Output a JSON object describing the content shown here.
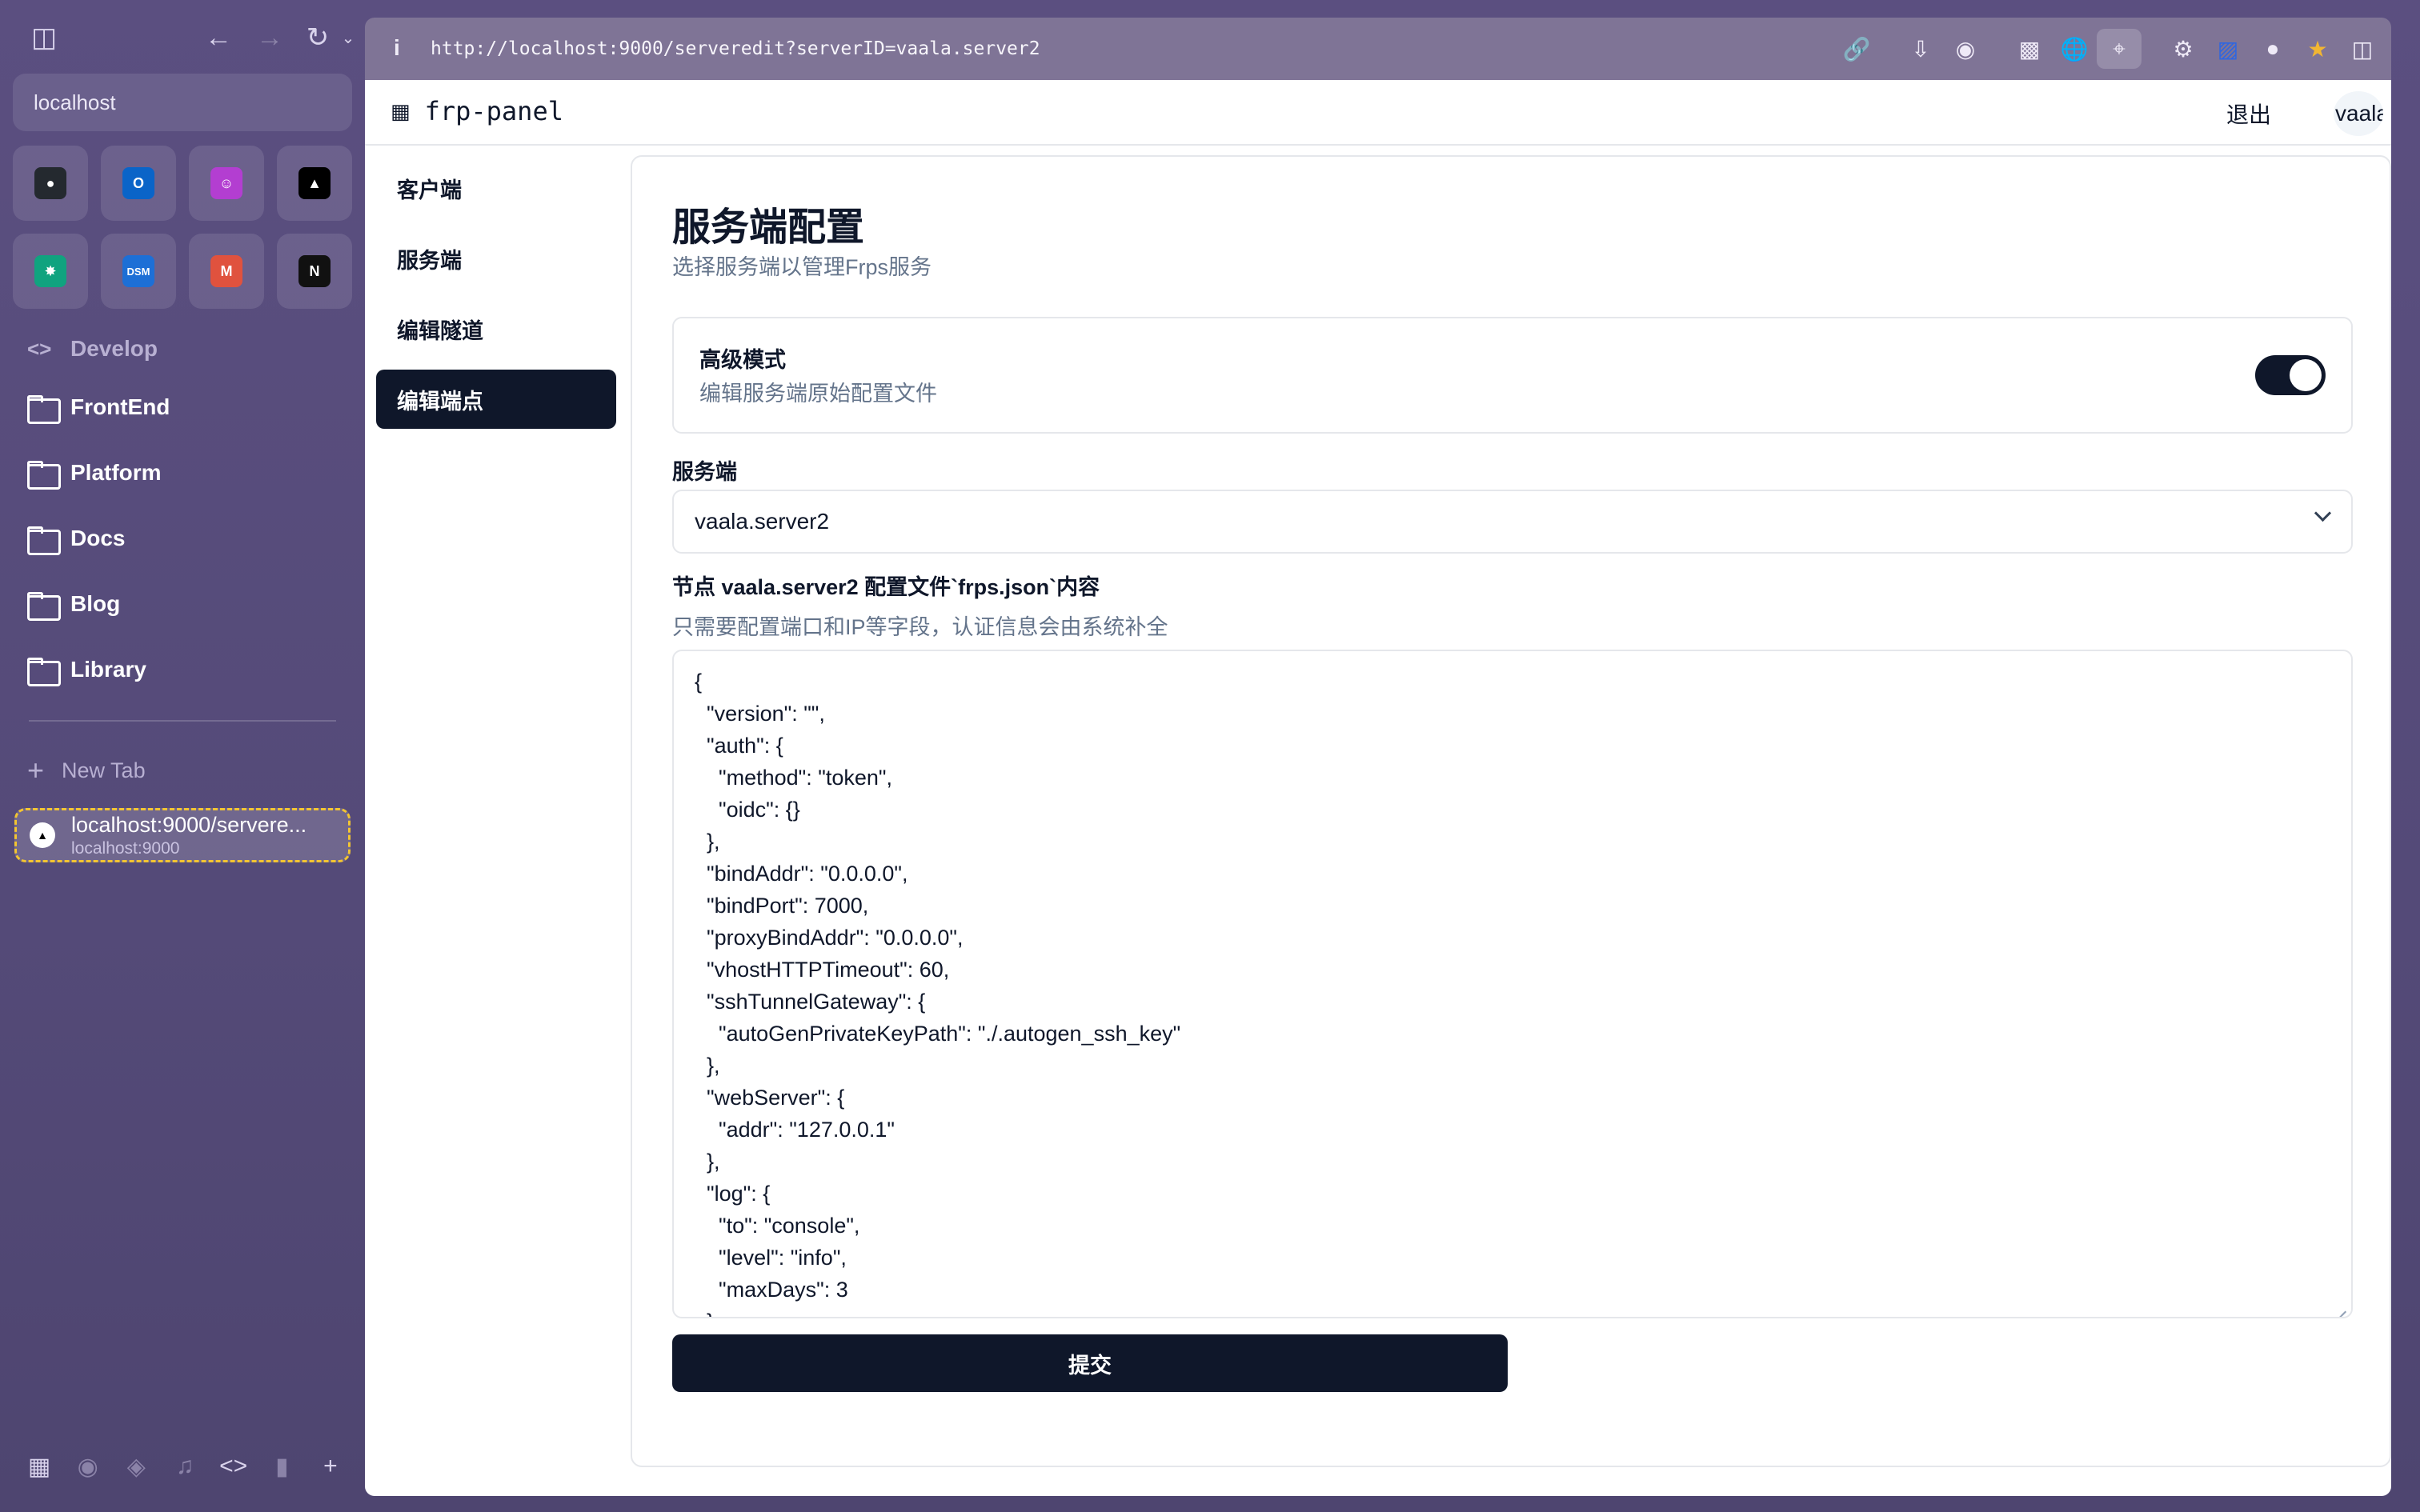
{
  "browser": {
    "url": "http://localhost:9000/serveredit?serverID=vaala.server2",
    "search_value": "localhost",
    "favorites": [
      {
        "icon": "github-icon",
        "symbol": "●",
        "color": "#24292f"
      },
      {
        "icon": "outlook-icon",
        "symbol": "O",
        "color": "#0a64c8"
      },
      {
        "icon": "chat-bot-icon",
        "symbol": "☺",
        "color": "#b33ed1"
      },
      {
        "icon": "vercel-icon",
        "symbol": "▲",
        "color": "#000000"
      },
      {
        "icon": "chatgpt-icon",
        "symbol": "✸",
        "color": "#10a37f"
      },
      {
        "icon": "dsm-icon",
        "symbol": "DSM",
        "color": "#1d6fd6"
      },
      {
        "icon": "gmail-icon",
        "symbol": "M",
        "color": "#e0523e"
      },
      {
        "icon": "notion-icon",
        "symbol": "N",
        "color": "#111111"
      }
    ],
    "sidebar": {
      "develop": "Develop",
      "folders": [
        "FrontEnd",
        "Platform",
        "Docs",
        "Blog",
        "Library"
      ],
      "new_tab": "New Tab",
      "active_tab_title": "localhost:9000/servere...",
      "active_tab_host": "localhost:9000"
    }
  },
  "app": {
    "brand": "frp-panel",
    "logout": "退出",
    "user": "vaala",
    "nav": [
      {
        "label": "客户端",
        "active": false
      },
      {
        "label": "服务端",
        "active": false
      },
      {
        "label": "编辑隧道",
        "active": false
      },
      {
        "label": "编辑端点",
        "active": true
      }
    ],
    "page": {
      "title": "服务端配置",
      "subtitle": "选择服务端以管理Frps服务",
      "advanced_title": "高级模式",
      "advanced_desc": "编辑服务端原始配置文件",
      "advanced_enabled": true,
      "server_label": "服务端",
      "server_selected": "vaala.server2",
      "file_label": "节点 vaala.server2 配置文件`frps.json`内容",
      "file_hint": "只需要配置端口和IP等字段，认证信息会由系统补全",
      "config_text": "{\n  \"version\": \"\",\n  \"auth\": {\n    \"method\": \"token\",\n    \"oidc\": {}\n  },\n  \"bindAddr\": \"0.0.0.0\",\n  \"bindPort\": 7000,\n  \"proxyBindAddr\": \"0.0.0.0\",\n  \"vhostHTTPTimeout\": 60,\n  \"sshTunnelGateway\": {\n    \"autoGenPrivateKeyPath\": \"./.autogen_ssh_key\"\n  },\n  \"webServer\": {\n    \"addr\": \"127.0.0.1\"\n  },\n  \"log\": {\n    \"to\": \"console\",\n    \"level\": \"info\",\n    \"maxDays\": 3\n  }\n}",
      "submit": "提交"
    }
  }
}
